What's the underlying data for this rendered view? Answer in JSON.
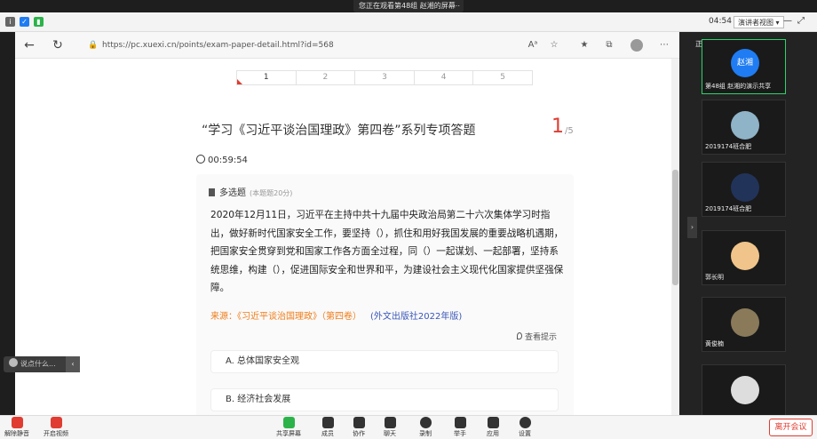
{
  "share_banner": {
    "text": "您正在观看第48组 赵湘的屏幕",
    "more": "⋯"
  },
  "status_bar": {
    "time": "04:54",
    "view_label": "演讲者视图"
  },
  "browser": {
    "url": "https://pc.xuexi.cn/points/exam-paper-detail.html?id=568"
  },
  "exam": {
    "pages": [
      "1",
      "2",
      "3",
      "4",
      "5"
    ],
    "title": "“学习《习近平谈治国理政》第四卷”系列专项答题",
    "current": "1",
    "total": "/5",
    "timer": "00:59:54",
    "question_type": "多选题",
    "question_score": "(本题题20分)",
    "question_text": "2020年12月11日，习近平在主持中共十九届中央政治局第二十六次集体学习时指出，做好新时代国家安全工作，要坚持（），抓住和用好我国发展的重要战略机遇期，把国家安全贯穿到党和国家工作各方面全过程，同（）一起谋划、一起部署，坚持系统思维，构建（），促进国际安全和世界和平，为建设社会主义现代化国家提供坚强保障。",
    "source": "来源：《习近平谈治国理政》（第四卷）",
    "publisher": "(外文出版社2022年版)",
    "hint": "查看提示",
    "options": [
      "A. 总体国家安全观",
      "B. 经济社会发展"
    ]
  },
  "mini_panel": {
    "text": "说点什么..."
  },
  "side_panel": {
    "speaking": "正在讲话: 第48组 赵湘",
    "tiles": [
      {
        "label": "第48组 赵湘的演示共享",
        "avatar": "赵湘"
      },
      {
        "label": "2019174班合肥"
      },
      {
        "label": "2019174班合肥"
      },
      {
        "label": "郭长明"
      },
      {
        "label": "黄俊楠"
      },
      {
        "label": ""
      }
    ]
  },
  "toolbar": {
    "items": [
      "解除静音",
      "开启视频",
      "共享屏幕",
      "成员",
      "协作",
      "聊天",
      "录制",
      "举手",
      "应用",
      "设置"
    ],
    "leave": "离开会议"
  }
}
